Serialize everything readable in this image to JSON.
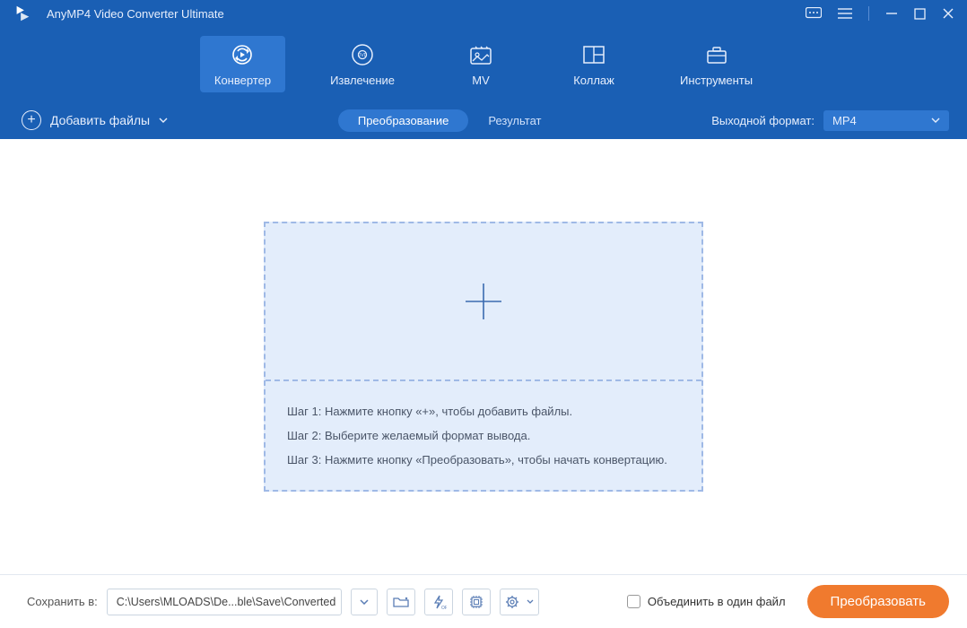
{
  "app": {
    "title": "AnyMP4 Video Converter Ultimate"
  },
  "nav": {
    "converter": "Конвертер",
    "ripper": "Извлечение",
    "mv": "MV",
    "collage": "Коллаж",
    "toolbox": "Инструменты"
  },
  "toolbar": {
    "add_files": "Добавить файлы",
    "tab_convert": "Преобразование",
    "tab_result": "Результат",
    "output_format_label": "Выходной формат:",
    "output_format_value": "MP4"
  },
  "dropzone": {
    "step1": "Шаг 1: Нажмите кнопку «+», чтобы добавить файлы.",
    "step2": "Шаг 2: Выберите желаемый формат вывода.",
    "step3": "Шаг 3: Нажмите кнопку «Преобразовать», чтобы начать конвертацию."
  },
  "bottom": {
    "save_to_label": "Сохранить в:",
    "save_path": "C:\\Users\\MLOADS\\De...ble\\Save\\Converted",
    "merge_label": "Объединить в один файл",
    "convert_button": "Преобразовать"
  }
}
